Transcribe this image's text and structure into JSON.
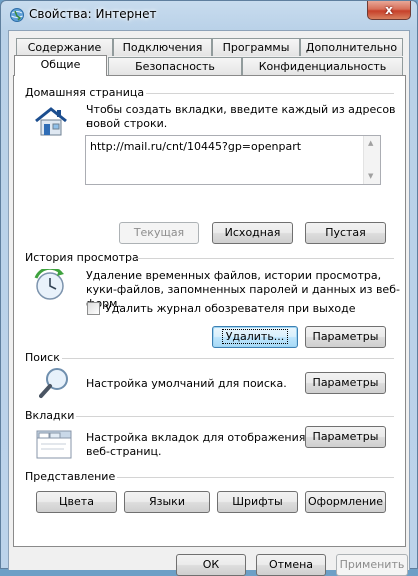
{
  "window": {
    "title": "Свойства: Интернет",
    "close_glyph": "x"
  },
  "tabs_row1": [
    {
      "label": "Содержание"
    },
    {
      "label": "Подключения"
    },
    {
      "label": "Программы"
    },
    {
      "label": "Дополнительно"
    }
  ],
  "tabs_row2": [
    {
      "label": "Общие",
      "active": true
    },
    {
      "label": "Безопасность"
    },
    {
      "label": "Конфиденциальность"
    }
  ],
  "home": {
    "header": "Домашняя страница",
    "description_line1": "Чтобы создать вкладки, введите каждый из адресов с",
    "description_line2": "новой строки.",
    "url": "http://mail.ru/cnt/10445?gp=openpart",
    "buttons": {
      "current": "Текущая",
      "default": "Исходная",
      "blank": "Пустая"
    }
  },
  "history": {
    "header": "История просмотра",
    "description_line1": "Удаление временных файлов, истории просмотра,",
    "description_line2": "куки-файлов, запомненных паролей и данных из веб-форм.",
    "checkbox_label": "Удалить журнал обозревателя при выходе",
    "checkbox_checked": false,
    "buttons": {
      "delete": "Удалить...",
      "settings": "Параметры"
    }
  },
  "search": {
    "header": "Поиск",
    "description": "Настройка умолчаний для поиска.",
    "settings": "Параметры"
  },
  "tabs_section": {
    "header": "Вкладки",
    "description_line1": "Настройка вкладок для отображения",
    "description_line2": "веб-страниц.",
    "settings": "Параметры"
  },
  "appearance": {
    "header": "Представление",
    "buttons": [
      "Цвета",
      "Языки",
      "Шрифты",
      "Оформление"
    ]
  },
  "footer": {
    "ok": "ОК",
    "cancel": "Отмена",
    "apply": "Применить"
  },
  "colors": {
    "title_bg": "#bcd3ea",
    "panel_bg": "#ffffff",
    "dialog_bg": "#f0f0f0",
    "close_red": "#c7402a"
  }
}
